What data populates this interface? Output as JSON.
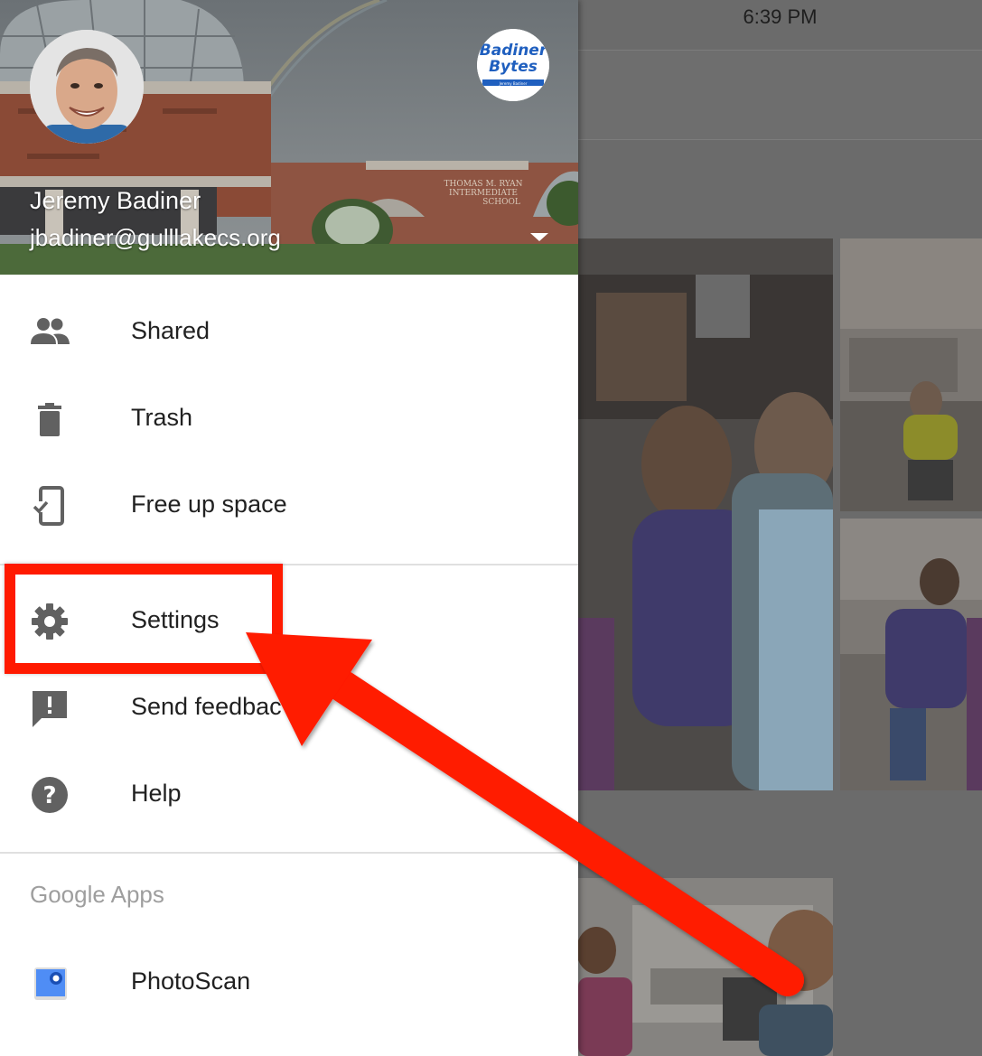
{
  "status_bar": {
    "time": "6:39 PM"
  },
  "header": {
    "user_name": "Jeremy Badiner",
    "user_email": "jbadiner@gulllakecs.org",
    "logo_line1": "Badiner",
    "logo_line2": "Bytes",
    "logo_byline": "Jeremy Badiner"
  },
  "menu": {
    "items": [
      {
        "label": "Shared",
        "icon": "people-icon"
      },
      {
        "label": "Trash",
        "icon": "trash-icon"
      },
      {
        "label": "Free up space",
        "icon": "phone-check-icon"
      },
      {
        "label": "Settings",
        "icon": "gear-icon"
      },
      {
        "label": "Send feedbac",
        "icon": "feedback-icon"
      },
      {
        "label": "Help",
        "icon": "help-icon"
      }
    ],
    "section_label": "Google Apps",
    "apps": [
      {
        "label": "PhotoScan",
        "icon": "photoscan-icon"
      }
    ]
  },
  "colors": {
    "annotation": "#ff1a00",
    "icon_gray": "#616161",
    "section_gray": "#9e9e9e"
  }
}
